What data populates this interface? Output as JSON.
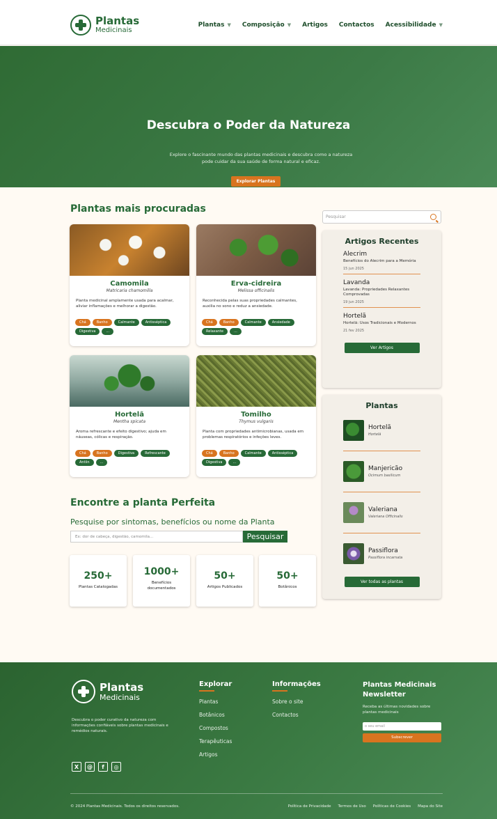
{
  "header": {
    "logo_line1": "Plantas",
    "logo_line2": "Medicinais",
    "nav": [
      {
        "label": "Plantas",
        "dropdown": true
      },
      {
        "label": "Composição",
        "dropdown": true
      },
      {
        "label": "Artigos",
        "dropdown": false
      },
      {
        "label": "Contactos",
        "dropdown": false
      },
      {
        "label": "Acessibilidade",
        "dropdown": true
      }
    ]
  },
  "hero": {
    "title": "Descubra o Poder da Natureza",
    "text": "Explore o fascinante mundo das plantas medicinais e descubra como a natureza pode cuidar da sua saúde de forma natural e eficaz.",
    "button": "Explorar Plantas"
  },
  "popular": {
    "title": "Plantas mais procuradas",
    "cards": [
      {
        "name": "Camomila",
        "sci": "Matricaria chamomilla",
        "desc": "Planta medicinal amplamente usada para acalmar, aliviar inflamações e melhorar a digestão.",
        "tags": [
          {
            "t": "Chá",
            "o": true
          },
          {
            "t": "Banho",
            "o": true
          },
          {
            "t": "Calmante",
            "o": false
          },
          {
            "t": "Antisséptica",
            "o": false
          },
          {
            "t": "Digestiva",
            "o": false
          },
          {
            "t": "...",
            "o": false
          }
        ]
      },
      {
        "name": "Erva-cidreira",
        "sci": "Melissa officinalis",
        "desc": "Reconhecida pelas suas propriedades calmantes, auxilia no sono e reduz a ansiedade.",
        "tags": [
          {
            "t": "Chá",
            "o": true
          },
          {
            "t": "Banho",
            "o": true
          },
          {
            "t": "Calmante",
            "o": false
          },
          {
            "t": "Ansiedade",
            "o": false
          },
          {
            "t": "Relaxante",
            "o": false
          },
          {
            "t": "...",
            "o": false
          }
        ]
      },
      {
        "name": "Hortelã",
        "sci": "Mentha spicata",
        "desc": "Aroma refrescante e efeito digestivo; ajuda em náuseas, cólicas e respiração.",
        "tags": [
          {
            "t": "Chá",
            "o": true
          },
          {
            "t": "Banho",
            "o": true
          },
          {
            "t": "Digestiva",
            "o": false
          },
          {
            "t": "Refrescante",
            "o": false
          },
          {
            "t": "Antiin",
            "o": false
          },
          {
            "t": "...",
            "o": false
          }
        ]
      },
      {
        "name": "Tomilho",
        "sci": "Thymus vulgaris",
        "desc": "Planta com propriedades antimicrobianas, usada em problemas respiratórios e infeções leves.",
        "tags": [
          {
            "t": "Chá",
            "o": true
          },
          {
            "t": "Banho",
            "o": true
          },
          {
            "t": "Calmante",
            "o": false
          },
          {
            "t": "Antisséptica",
            "o": false
          },
          {
            "t": "Digestiva",
            "o": false
          },
          {
            "t": "...",
            "o": false
          }
        ]
      }
    ]
  },
  "finder": {
    "title": "Encontre a planta Perfeita",
    "subtitle": "Pesquise por sintomas, benefícios ou nome da Planta",
    "placeholder": "Ex: dor de cabeça, digestão, camomila...",
    "button": "Pesquisar"
  },
  "stats": [
    {
      "num": "250+",
      "label": "Plantas Catalogadas"
    },
    {
      "num": "1000+",
      "label": "Benefícios documentados"
    },
    {
      "num": "50+",
      "label": "Artigos Publicados"
    },
    {
      "num": "50+",
      "label": "Botânicos"
    }
  ],
  "sidebar": {
    "search_placeholder": "Pesquisar",
    "articles_title": "Artigos Recentes",
    "articles": [
      {
        "title": "Alecrim",
        "desc": "Benefícios do Alecrim para a Memória",
        "date": "15 jun 2025"
      },
      {
        "title": "Lavanda",
        "desc": "Lavanda: Propriedades Relaxantes Comprovadas",
        "date": "19 jun 2025"
      },
      {
        "title": "Hortelã",
        "desc": "Hortelã: Usos Tradicionais e Modernos",
        "date": "21 fev 2025"
      }
    ],
    "articles_button": "Ver Artigos",
    "plants_title": "Plantas",
    "plants": [
      {
        "name": "Hortelã",
        "sci": "Hortelã"
      },
      {
        "name": "Manjericão",
        "sci": "Ocimum basilicum"
      },
      {
        "name": "Valeriana",
        "sci": "Valeriana Officinalis"
      },
      {
        "name": "Passiflora",
        "sci": "Passiflora incarnata"
      }
    ],
    "plants_button": "Ver todas as plantas"
  },
  "footer": {
    "logo_line1": "Plantas",
    "logo_line2": "Medicinais",
    "desc": "Descubra o poder curativo da natureza com informações confiáveis sobre plantas medicinais e remédios naturais.",
    "social": [
      "X",
      "@",
      "f",
      "◎"
    ],
    "explore_title": "Explorar",
    "explore_links": [
      "Plantas",
      "Botânicos",
      "Compostos",
      "Terapêuticas",
      "Artigos"
    ],
    "info_title": "Informações",
    "info_links": [
      "Sobre o site",
      "Contactos"
    ],
    "newsletter_title": "Plantas Medicinais Newsletter",
    "newsletter_desc": "Receba as últimas novidades sobre plantas medicinais",
    "email_placeholder": "o seu email",
    "subscribe": "Subscrever",
    "copyright": "© 2024 Plantas Medicinais. Todos os direitos reservados.",
    "legal": [
      "Política de Privacidade",
      "Termos de Uso",
      "Políticas de Cookies",
      "Mapa do Site"
    ]
  },
  "colors": {
    "green": "#276a37",
    "orange": "#d8741f",
    "cream": "#fffaf3"
  }
}
